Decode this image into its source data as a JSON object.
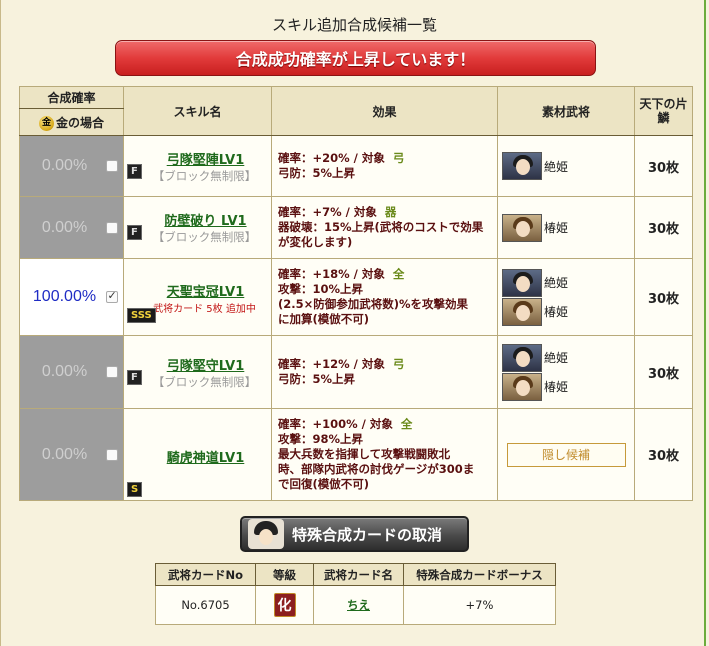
{
  "title": "スキル追加合成候補一覧",
  "banner": "合成成功確率が上昇しています！",
  "table": {
    "headers": {
      "rate": "合成確率",
      "rate_gold": "金の場合",
      "skill": "スキル名",
      "effect": "効果",
      "material": "素材武将",
      "cost": "天下の片鱗"
    },
    "rows": [
      {
        "rate": "0.00%",
        "checked": false,
        "rank": "F",
        "skill": "弓隊堅陣LV1",
        "sub": "【ブロック無制限】",
        "note": "",
        "effect": [
          "確率：+20%",
          "弓防：5%上昇"
        ],
        "target_label": "対象",
        "target": "弓",
        "materials": [
          "絶姫"
        ],
        "cost": "30枚"
      },
      {
        "rate": "0.00%",
        "checked": false,
        "rank": "F",
        "skill": "防壁破り LV1",
        "sub": "【ブロック無制限】",
        "note": "",
        "effect": [
          "確率：+7%",
          "器破壊：15%上昇(武将のコストで効果",
          "が変化します)"
        ],
        "target_label": "対象",
        "target": "器",
        "materials": [
          "椿姫"
        ],
        "cost": "30枚"
      },
      {
        "rate": "100.00%",
        "checked": true,
        "rank": "SSS",
        "skill": "天聖宝冠LV1",
        "sub": "",
        "note": "武将カード 5枚 追加中",
        "effect": [
          "確率：+18%",
          "攻撃：10%上昇",
          "(2.5×防御参加武将数)%を攻撃効果",
          "に加算(模倣不可)"
        ],
        "target_label": "対象",
        "target": "全",
        "materials": [
          "絶姫",
          "椿姫"
        ],
        "cost": "30枚"
      },
      {
        "rate": "0.00%",
        "checked": false,
        "rank": "F",
        "skill": "弓隊堅守LV1",
        "sub": "【ブロック無制限】",
        "note": "",
        "effect": [
          "確率：+12%",
          "弓防：5%上昇"
        ],
        "target_label": "対象",
        "target": "弓",
        "materials": [
          "絶姫",
          "椿姫"
        ],
        "cost": "30枚"
      },
      {
        "rate": "0.00%",
        "checked": false,
        "rank": "S",
        "skill": "騎虎神道LV1",
        "sub": "",
        "note": "",
        "effect": [
          "確率：+100%",
          "攻撃：98%上昇",
          "最大兵数を指揮して攻撃戦闘敗北",
          "時、部隊内武将の討伐ゲージが300ま",
          "で回復(模倣不可)"
        ],
        "target_label": "対象",
        "target": "全",
        "materials": [],
        "hidden_label": "隠し候補",
        "cost": "30枚"
      }
    ]
  },
  "cancel_button": "特殊合成カードの取消",
  "card_table": {
    "headers": [
      "武将カードNo",
      "等級",
      "武将カード名",
      "特殊合成カードボーナス"
    ],
    "row": {
      "no": "No.6705",
      "grade": "化",
      "name": "ちえ",
      "bonus": "+7%"
    }
  }
}
